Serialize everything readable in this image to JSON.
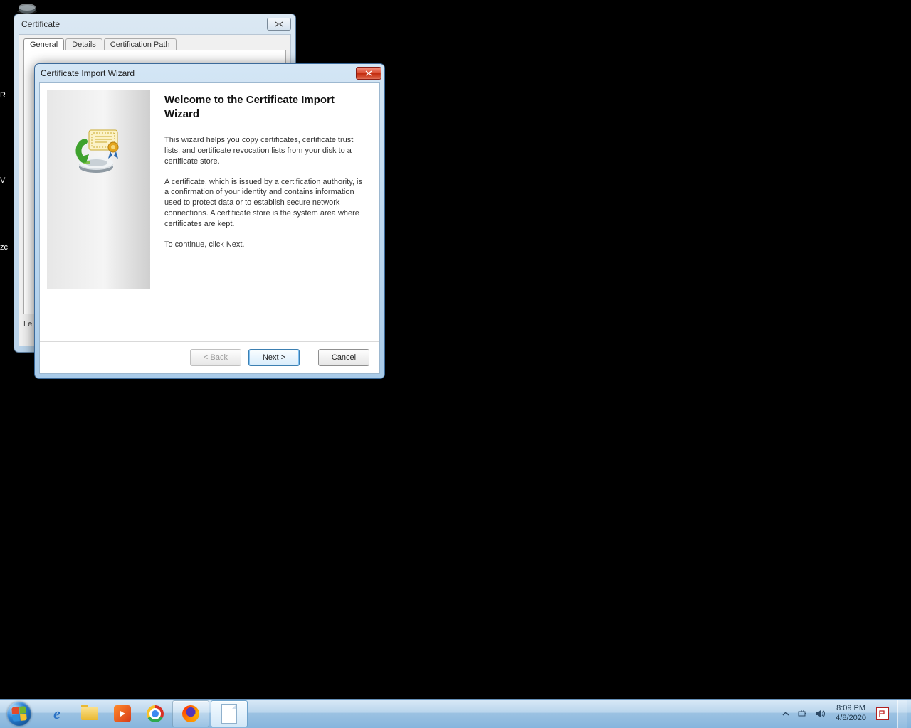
{
  "desktop": {
    "left_fragments": [
      "R",
      "V",
      "zc"
    ]
  },
  "cert_window": {
    "title": "Certificate",
    "tabs": [
      "General",
      "Details",
      "Certification Path"
    ],
    "learn_label_prefix": "Le"
  },
  "wizard": {
    "title": "Certificate Import Wizard",
    "heading": "Welcome to the Certificate Import Wizard",
    "para1": "This wizard helps you copy certificates, certificate trust lists, and certificate revocation lists from your disk to a certificate store.",
    "para2": "A certificate, which is issued by a certification authority, is a confirmation of your identity and contains information used to protect data or to establish secure network connections. A certificate store is the system area where certificates are kept.",
    "para3": "To continue, click Next.",
    "buttons": {
      "back": "< Back",
      "next": "Next >",
      "cancel": "Cancel"
    }
  },
  "taskbar": {
    "clock_time": "8:09 PM",
    "clock_date": "4/8/2020"
  }
}
